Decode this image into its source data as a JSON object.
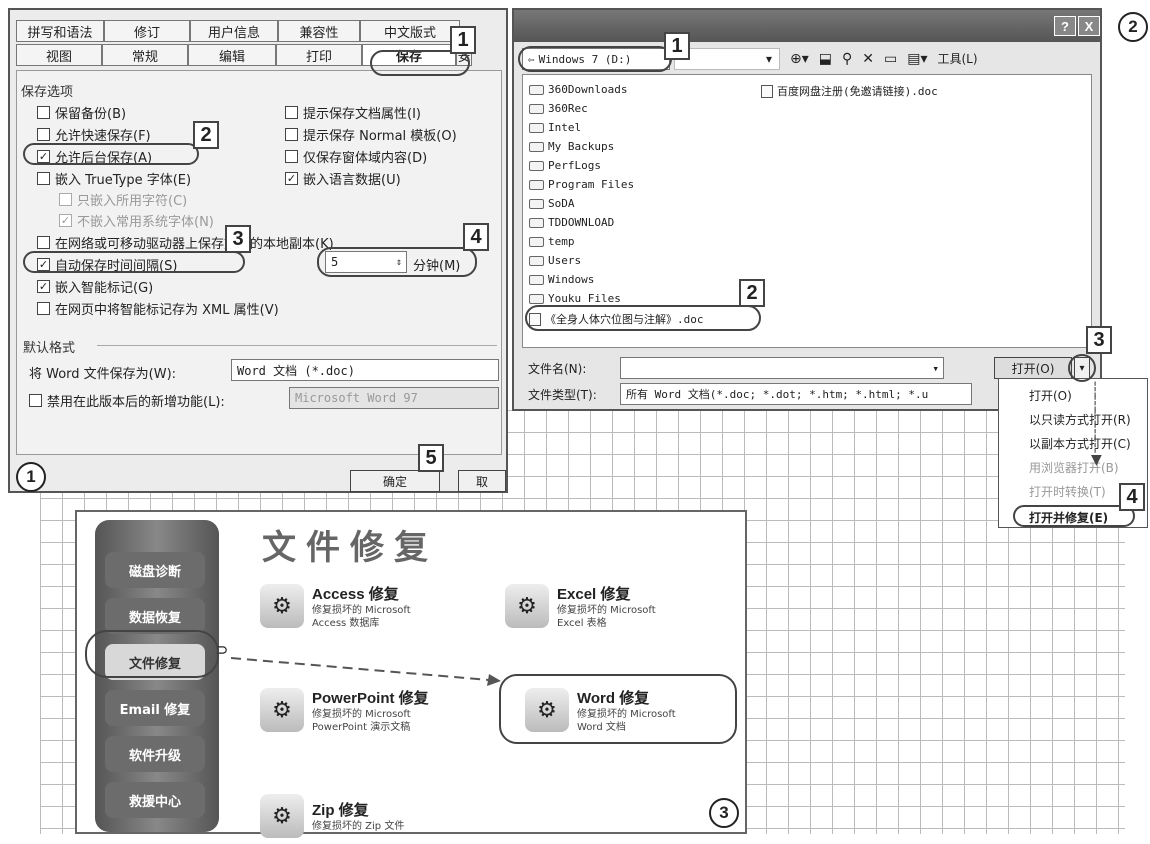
{
  "panel1": {
    "tabs_row1": [
      "拼写和语法",
      "修订",
      "用户信息",
      "兼容性",
      "中文版式"
    ],
    "tabs_row2": [
      "视图",
      "常规",
      "编辑",
      "打印",
      "保存"
    ],
    "active_tab": "保存",
    "tab_clipped": "安",
    "section_save_options": "保存选项",
    "opts_left": [
      {
        "label": "保留备份(B)",
        "checked": false
      },
      {
        "label": "允许快速保存(F)",
        "checked": false
      },
      {
        "label": "允许后台保存(A)",
        "checked": true
      },
      {
        "label": "嵌入 TrueType 字体(E)",
        "checked": false
      }
    ],
    "opts_sub": [
      {
        "label": "只嵌入所用字符(C)",
        "checked": false
      },
      {
        "label": "不嵌入常用系统字体(N)",
        "checked": true
      }
    ],
    "opts_right": [
      {
        "label": "提示保存文档属性(I)",
        "checked": false
      },
      {
        "label": "提示保存 Normal 模板(O)",
        "checked": false
      },
      {
        "label": "仅保存窗体域内容(D)",
        "checked": false
      },
      {
        "label": "嵌入语言数据(U)",
        "checked": true
      }
    ],
    "opt_network": "在网络或可移动驱动器上保存文件的本地副本(K)",
    "opt_autosave": "自动保存时间间隔(S)",
    "autosave_value": "5",
    "autosave_unit": "分钟(M)",
    "opt_smarttags": "嵌入智能标记(G)",
    "opt_xml": "在网页中将智能标记存为 XML 属性(V)",
    "section_default": "默认格式",
    "save_as_label": "将 Word 文件保存为(W):",
    "save_as_value": "Word 文档 (*.doc)",
    "disable_features_label": "禁用在此版本后的新增功能(L):",
    "disable_features_value": "Microsoft Word 97",
    "ok_button": "确定",
    "cancel_button": "取",
    "badges": [
      "1",
      "2",
      "3",
      "4",
      "5"
    ],
    "panel_number": "1"
  },
  "panel2": {
    "help_btn": "?",
    "close_btn": "X",
    "location": "Windows 7 (D:)",
    "toolbar_tools": "工具(L)",
    "folders": [
      "360Downloads",
      "360Rec",
      "Intel",
      "My Backups",
      "PerfLogs",
      "Program Files",
      "SoDA",
      "TDDOWNLOAD",
      "temp",
      "Users",
      "Windows",
      "Youku Files"
    ],
    "selected_file": "《全身人体穴位图与注解》.doc",
    "right_file": "百度网盘注册(免邀请链接).doc",
    "filename_label": "文件名(N):",
    "filetype_label": "文件类型(T):",
    "filetype_value": "所有 Word 文档(*.doc; *.dot; *.htm; *.html; *.u",
    "open_button": "打开(O)",
    "menu_items": [
      "打开(O)",
      "以只读方式打开(R)",
      "以副本方式打开(C)",
      "用浏览器打开(B)",
      "打开时转换(T)",
      "打开并修复(E)"
    ],
    "badges": [
      "1",
      "2",
      "3",
      "4"
    ],
    "panel_number": "2"
  },
  "panel3": {
    "title": "文件修复",
    "sidebar": [
      "磁盘诊断",
      "数据恢复",
      "文件修复",
      "Email 修复",
      "软件升级",
      "救援中心"
    ],
    "cards": [
      {
        "name": "Access 修复",
        "desc1": "修复损坏的 Microsoft",
        "desc2": "Access 数据库"
      },
      {
        "name": "Excel 修复",
        "desc1": "修复损坏的 Microsoft",
        "desc2": "Excel 表格"
      },
      {
        "name": "PowerPoint 修复",
        "desc1": "修复损坏的 Microsoft",
        "desc2": "PowerPoint 演示文稿"
      },
      {
        "name": "Word 修复",
        "desc1": "修复损坏的 Microsoft",
        "desc2": "Word 文档"
      },
      {
        "name": "Zip 修复",
        "desc1": "修复损坏的 Zip 文件",
        "desc2": ""
      }
    ],
    "panel_number": "3"
  }
}
